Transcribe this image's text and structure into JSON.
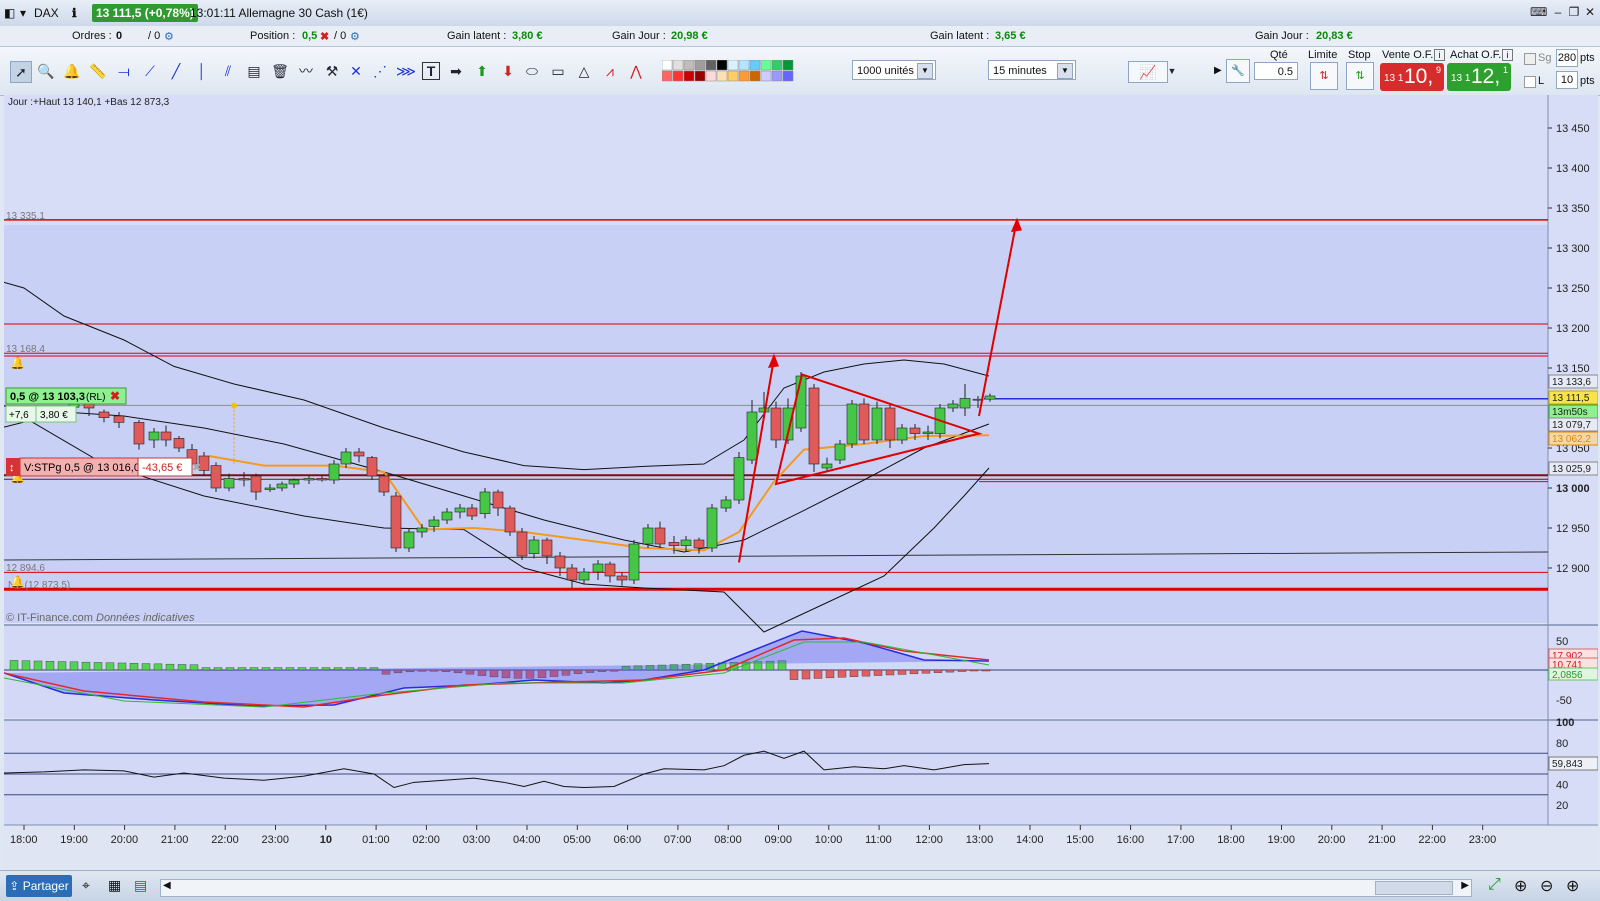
{
  "titlebar": {
    "instrument": "DAX",
    "price_badge": "13 111,5 (+0,78%)",
    "time_title": "13:01:11 Allemagne 30 Cash (1€)"
  },
  "infobar": {
    "ordres_label": "Ordres :",
    "ordres_value": "0",
    "ordres_slash": "/ 0",
    "position_label": "Position :",
    "position_value": "0,5",
    "position_slash": "/ 0",
    "gain_latent_label": "Gain latent :",
    "gain_latent_value": "3,80 €",
    "gain_jour_label": "Gain Jour :",
    "gain_jour_value": "20,98 €",
    "gain_latent2_label": "Gain latent :",
    "gain_latent2_value": "3,65 €",
    "gain_jour2_label": "Gain Jour :",
    "gain_jour2_value": "20,83 €"
  },
  "toolbar": {
    "units_select": "1000 unités",
    "interval_select": "15 minutes",
    "qte_label": "Qté",
    "qte_value": "0.5",
    "limite_label": "Limite",
    "stop_label": "Stop",
    "vente_label": "Vente O.F.",
    "achat_label": "Achat O.F.",
    "vente_small": "13 1",
    "vente_big": "10,",
    "vente_sup": "9",
    "achat_small": "13 1",
    "achat_big": "12,",
    "achat_sup": "1",
    "sg_label": "Sg",
    "l_label": "L",
    "pts_value1": "280",
    "pts_value2": "10",
    "pts_label": "pts"
  },
  "chart": {
    "header_text": "Jour :+Haut 13 140,1 +Bas 12 873,3",
    "source_text": "© IT-Finance.com",
    "source_note": "Données indicatives",
    "level_13335": "13 335,1",
    "level_13168": "13 168,4",
    "level_12894": "12 894,6",
    "level_ns": "NS (12 873,5)",
    "position_box": "0,5 @ 13 103,3",
    "position_box_tag": "(RL)",
    "position_pts": "+7,6",
    "position_gain": "3,80 €",
    "stop_box": "V:STPg  0,5 @ 13 016,0",
    "stop_gain": "-43,65 €",
    "y_ticks": [
      "13 450",
      "13 400",
      "13 350",
      "13 300",
      "13 250",
      "13 200",
      "13 150",
      "13 050",
      "13 000",
      "12 950",
      "12 900"
    ],
    "right_labels": {
      "l1": "13 133,6",
      "l2": "13 111,5",
      "l3": "13m50s",
      "l4": "13 079,7",
      "l5": "13 062,2",
      "l6": "13 025,9"
    },
    "x_ticks": [
      "18:00",
      "19:00",
      "20:00",
      "21:00",
      "22:00",
      "23:00",
      "10",
      "01:00",
      "02:00",
      "03:00",
      "04:00",
      "05:00",
      "06:00",
      "07:00",
      "08:00",
      "09:00",
      "10:00",
      "11:00",
      "12:00",
      "13:00",
      "14:00",
      "15:00",
      "16:00",
      "17:00",
      "18:00",
      "19:00",
      "20:00",
      "21:00",
      "22:00",
      "23:00"
    ],
    "macd_ticks": [
      "50",
      "-50"
    ],
    "macd_labels": [
      "17,902",
      "10,741",
      "2,0856"
    ],
    "rsi_ticks": [
      "100",
      "80",
      "60",
      "40",
      "20"
    ],
    "rsi_label": "59,843"
  },
  "statusbar": {
    "share_label": "Partager"
  },
  "colors": {
    "up_candle": "#45c745",
    "down_candle": "#e05a5a",
    "red_line": "#e00000",
    "blue_line": "#1f33d6",
    "orange_line": "#f39a1f"
  }
}
